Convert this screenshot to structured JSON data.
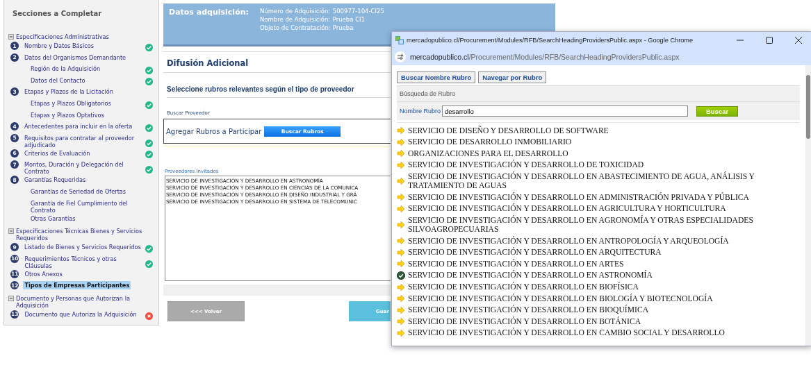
{
  "sidebar": {
    "title": "Secciones a Completar",
    "groups": [
      {
        "label": "Especificaciones Administrativas",
        "expanded": true,
        "items": [
          {
            "number": "1",
            "label": "Nombre y Datos Básicos",
            "complete": true,
            "selected": false
          },
          {
            "number": "2",
            "label": "Datos del Organismos Demandante",
            "complete": false,
            "selected": false,
            "children": [
              {
                "label": "Región de la Adquisición",
                "complete": true,
                "selected": false
              },
              {
                "label": "Datos del Contacto",
                "complete": true,
                "selected": false
              }
            ]
          },
          {
            "number": "3",
            "label": "Etapas y Plazos de la Licitación",
            "complete": false,
            "selected": false,
            "children": [
              {
                "label": "Etapas y Plazos Obligatorios",
                "complete": true,
                "selected": false
              },
              {
                "label": "Etapas y Plazos Optativos",
                "complete": false,
                "selected": false
              }
            ]
          },
          {
            "number": "4",
            "label": "Antecedentes para incluir en la oferta",
            "complete": true,
            "selected": false
          },
          {
            "number": "5",
            "label": "Requisitos para contratar al proveedor adjudicado",
            "complete": true,
            "selected": false
          },
          {
            "number": "6",
            "label": "Criterios de Evaluación",
            "complete": true,
            "selected": false
          },
          {
            "number": "7",
            "label": "Montos, Duración y Delegación del Contrato",
            "complete": true,
            "selected": false
          },
          {
            "number": "8",
            "label": "Garantías Requeridas",
            "complete": false,
            "selected": false,
            "children": [
              {
                "label": "Garantías de Seriedad de Ofertas",
                "complete": false,
                "selected": false
              },
              {
                "label": "Garantía de Fiel Cumplimiento del Contrato",
                "complete": false,
                "selected": false
              },
              {
                "label": "Otras Garantías",
                "complete": false,
                "selected": false
              }
            ]
          }
        ]
      },
      {
        "label": "Especificaciones Técnicas Bienes y Servicios Requeridos",
        "expanded": true,
        "items": [
          {
            "number": "9",
            "label": "Listado de Bienes y Servicios Requeridos",
            "complete": true,
            "selected": false
          },
          {
            "number": "10",
            "label": "Requerimientos Técnicos y otras Cláusulas",
            "complete": true,
            "selected": false
          },
          {
            "number": "11",
            "label": "Otros Anexos",
            "complete": false,
            "selected": false
          },
          {
            "number": "12",
            "label": "Tipos de Empresas Participantes",
            "complete": false,
            "selected": true
          }
        ]
      },
      {
        "label": "Documento y Personas que Autorizan la Adquisición",
        "expanded": true,
        "items": [
          {
            "number": "13",
            "label": "Documento que Autoriza la Adquisición",
            "complete": false,
            "error": true,
            "selected": false
          }
        ]
      }
    ]
  },
  "header": {
    "title": "Datos adquisición:",
    "fields": [
      {
        "label": "Número de Adquisición:",
        "value": "500977-104-CI25"
      },
      {
        "label": "Nombre de Adquisición:",
        "value": "Prueba CI1"
      },
      {
        "label": "Objeto de Contratación:",
        "value": "Prueba"
      }
    ]
  },
  "section_title": "Difusión Adicional",
  "subtitle": "Seleccione rubros relevantes según el tipo de proveedor",
  "search_provider_label": "Buscar Proveedor",
  "add_label": "Agregar Rubros a Participar",
  "add_button": "Buscar Rubros",
  "invited": {
    "label": "Proveedores Invitados",
    "items": [
      "SERVICIO DE INVESTIGACIÓN Y DESARROLLO EN ASTRONOMÍA",
      "SERVICIO DE INVESTIGACIÓN Y DESARROLLO EN CIENCIAS DE LA COMUNICA",
      "SERVICIO DE INVESTIGACIÓN Y DESARROLLO EN DISEÑO INDUSTRIAL Y GRÁ",
      "SERVICIO DE INVESTIGACIÓN Y DESARROLLO EN SISTEMA DE TELECOMUNIC"
    ]
  },
  "back_button": "<<< Volver",
  "save_button": "Guar",
  "popup": {
    "title": "mercadopublico.cl/Procurement/Modules/RFB/SearchHeadingProvidersPublic.aspx - Google Chrome",
    "url_domain": "mercadopublico.cl",
    "url_path": "/Procurement/Modules/RFB/SearchHeadingProvidersPublic.aspx",
    "tab_buttons": [
      "Buscar Nombre Rubro",
      "Navegar por Rubro"
    ],
    "panel_title": "Búsqueda de Rubro",
    "field_label": "Nombre Rubro",
    "field_value": "desarrollo",
    "search_button": "Buscar",
    "results": [
      {
        "label": "SERVICIO DE DISEÑO Y DESARROLLO DE SOFTWARE",
        "selected": false
      },
      {
        "label": "SERVICIO DE DESARROLLO INMOBILIARIO",
        "selected": false
      },
      {
        "label": "ORGANIZACIONES PARA EL DESARROLLO",
        "selected": false
      },
      {
        "label": "SERVICIO DE INVESTIGACIÓN Y DESARROLLO DE TOXICIDAD",
        "selected": false
      },
      {
        "label": "SERVICIO DE INVESTIGACIÓN Y DESARROLLO EN ABASTECIMIENTO DE AGUA, ANÁLISIS Y TRATAMIENTO DE AGUAS",
        "selected": false
      },
      {
        "label": "SERVICIO DE INVESTIGACIÓN Y DESARROLLO EN ADMINISTRACIÓN PRIVADA Y PÚBLICA",
        "selected": false
      },
      {
        "label": "SERVICIO DE INVESTIGACIÓN Y DESARROLLO EN AGRICULTURA Y HORTICULTURA",
        "selected": false
      },
      {
        "label": "SERVICIO DE INVESTIGACIÓN Y DESARROLLO EN AGRONOMÍA Y OTRAS ESPECIALIDADES SILVOAGROPECUARIAS",
        "selected": false
      },
      {
        "label": "SERVICIO DE INVESTIGACIÓN Y DESARROLLO EN ANTROPOLOGÍA Y ARQUEOLOGÍA",
        "selected": false
      },
      {
        "label": "SERVICIO DE INVESTIGACIÓN Y DESARROLLO EN ARQUITECTURA",
        "selected": false
      },
      {
        "label": "SERVICIO DE INVESTIGACIÓN Y DESARROLLO EN ARTES",
        "selected": false
      },
      {
        "label": "SERVICIO DE INVESTIGACIÓN Y DESARROLLO EN ASTRONOMÍA",
        "selected": true
      },
      {
        "label": "SERVICIO DE INVESTIGACIÓN Y DESARROLLO EN BIOFÍSICA",
        "selected": false
      },
      {
        "label": "SERVICIO DE INVESTIGACIÓN Y DESARROLLO EN BIOLOGÍA Y BIOTECNOLOGÍA",
        "selected": false
      },
      {
        "label": "SERVICIO DE INVESTIGACIÓN Y DESARROLLO EN BIOQUÍMICA",
        "selected": false
      },
      {
        "label": "SERVICIO DE INVESTIGACIÓN Y DESARROLLO EN BOTÁNICA",
        "selected": false
      },
      {
        "label": "SERVICIO DE INVESTIGACIÓN Y DESARROLLO EN CAMBIO SOCIAL Y DESARROLLO",
        "selected": false
      }
    ]
  }
}
